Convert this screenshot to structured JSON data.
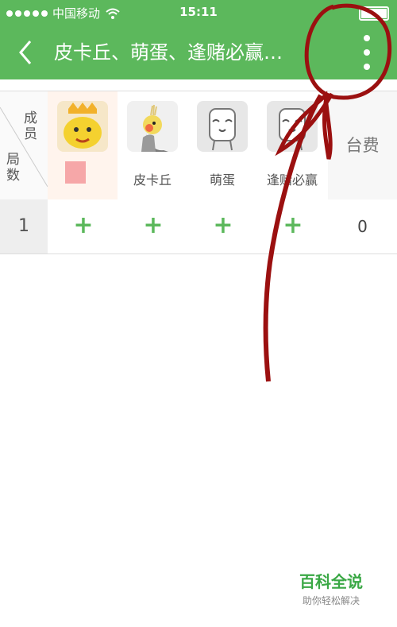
{
  "status_bar": {
    "carrier": "中国移动",
    "time": "15:11"
  },
  "nav": {
    "title": "皮卡丘、萌蛋、逢赌必赢…"
  },
  "table": {
    "corner_top": "成员",
    "corner_bottom": "局数",
    "members": [
      {
        "name": "",
        "avatar": "yellow-crown-avatar"
      },
      {
        "name": "皮卡丘",
        "avatar": "cockatiel-avatar"
      },
      {
        "name": "萌蛋",
        "avatar": "cartoon-face-avatar"
      },
      {
        "name": "逢赌必赢",
        "avatar": "cartoon-face-avatar"
      }
    ],
    "fee_label": "台费",
    "rows": [
      {
        "round": "1",
        "fee": "0"
      }
    ]
  },
  "watermark": {
    "title": "百科全说",
    "subtitle": "助你轻松解决"
  }
}
